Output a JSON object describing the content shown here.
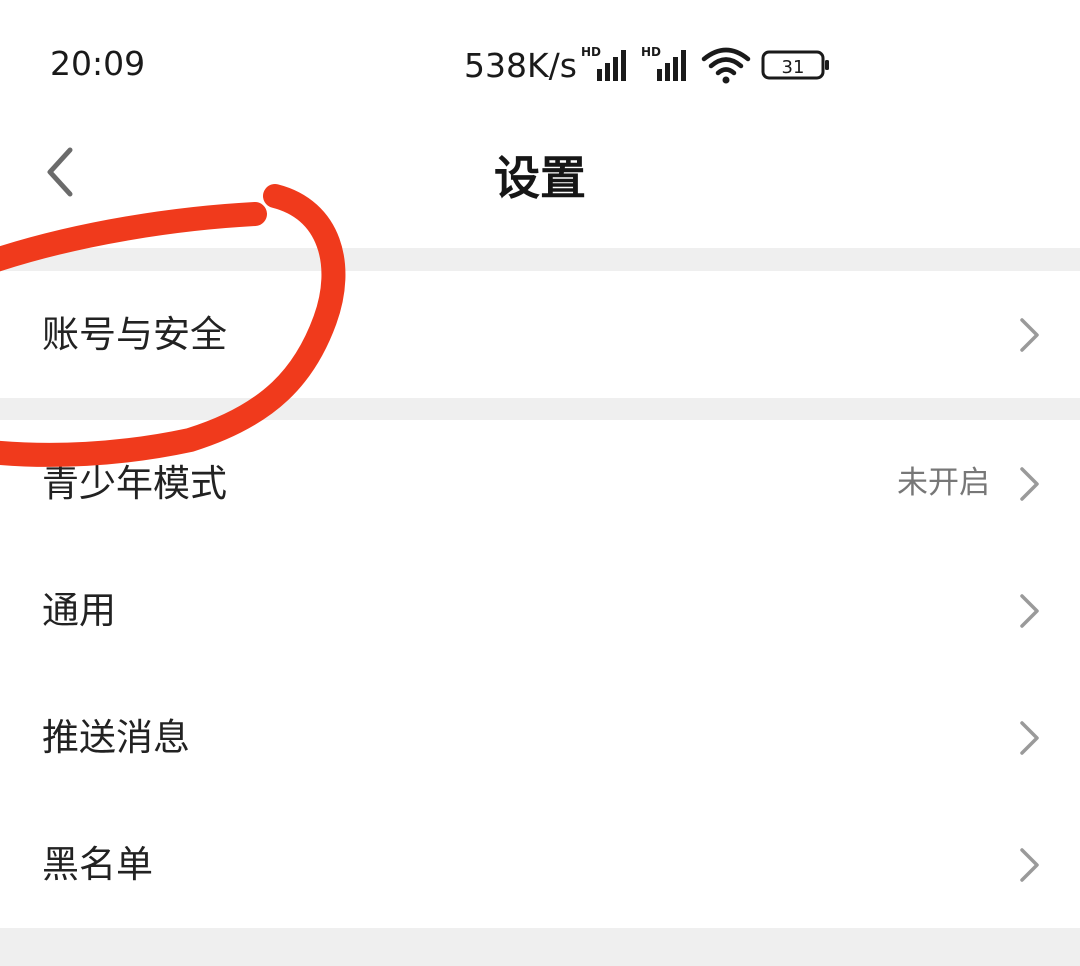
{
  "status_bar": {
    "time": "20:09",
    "net_speed": "538K/s",
    "signal_1_label": "HD",
    "signal_2_label": "HD",
    "battery_level": "31"
  },
  "header": {
    "title": "设置",
    "back_icon": "chevron-left-icon"
  },
  "settings": {
    "account_security": {
      "label": "账号与安全"
    },
    "teen_mode": {
      "label": "青少年模式",
      "value": "未开启"
    },
    "general": {
      "label": "通用"
    },
    "push_messages": {
      "label": "推送消息"
    },
    "blacklist": {
      "label": "黑名单"
    }
  },
  "colors": {
    "annotation": "#f03a1c",
    "separator": "#efefef",
    "chevron": "#9a9a9a",
    "secondary_text": "#777777"
  }
}
